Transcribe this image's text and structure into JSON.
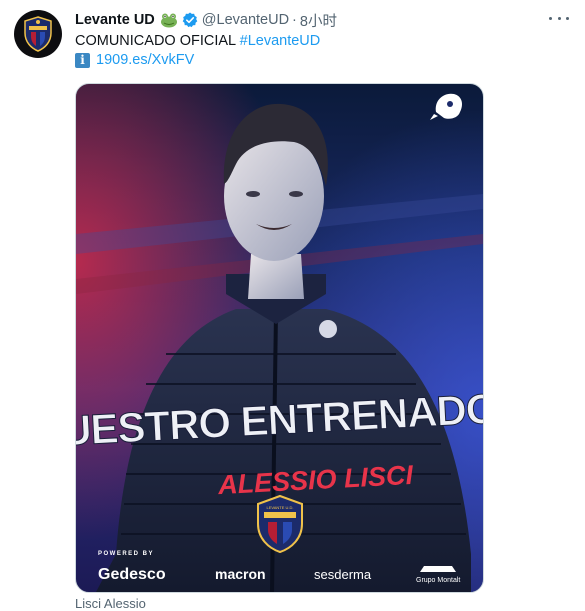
{
  "tweet": {
    "name": "Levante UD",
    "handle": "@LevanteUD",
    "separator": "·",
    "time": "8小时",
    "text_prefix": "COMUNICADO OFICIAL ",
    "hashtag": "#LevanteUD",
    "info_glyph": "i",
    "link": "1909.es/XvkFV"
  },
  "media": {
    "headline": "NUESTRO ENTRENADOR",
    "coach_name": "ALESSIO LISCI",
    "powered_by": "POWERED BY",
    "sponsors": [
      "Gedesco",
      "macron",
      "sesderma",
      "Grupo Montalt"
    ],
    "crest_text": "LEVANTE U.D.",
    "caption": "Lisci Alessio"
  },
  "colors": {
    "accent_blue": "#1d9bf0",
    "secondary_text": "#536471",
    "name_accent": "#e8344a",
    "headline_white": "#eef0f6"
  },
  "icons": [
    "club-avatar-icon",
    "frog-emoji-icon",
    "verified-badge-icon",
    "more-options-icon",
    "information-icon",
    "team-mascot-icon",
    "club-crest-icon"
  ]
}
